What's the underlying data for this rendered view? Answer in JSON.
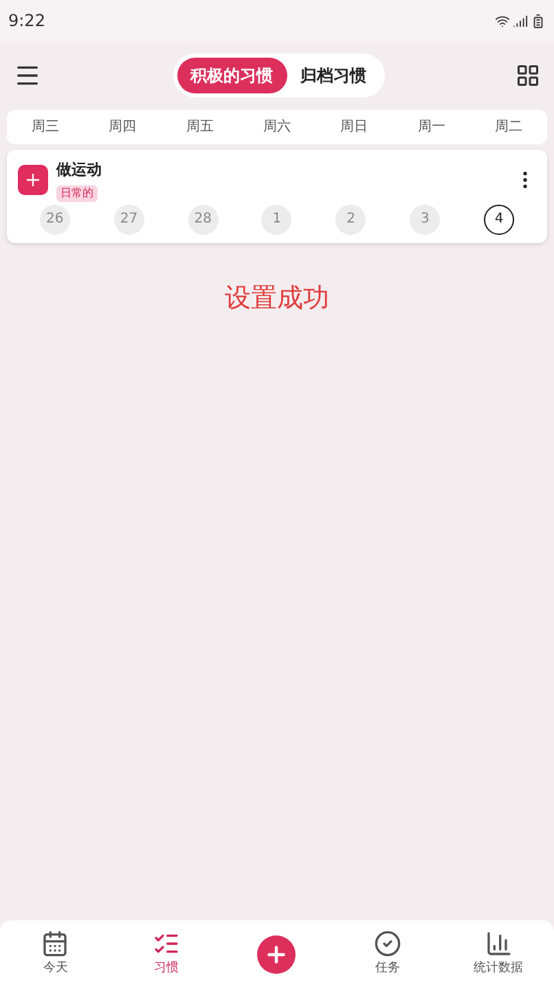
{
  "status_bar": {
    "time": "9:22"
  },
  "segments": [
    {
      "label": "积极的习惯",
      "selected": true
    },
    {
      "label": "归档习惯",
      "selected": false
    }
  ],
  "weekdays": [
    "周三",
    "周四",
    "周五",
    "周六",
    "周日",
    "周一",
    "周二"
  ],
  "habits": [
    {
      "name": "做运动",
      "tag": "日常的",
      "days": [
        {
          "label": "26",
          "selected": false
        },
        {
          "label": "27",
          "selected": false
        },
        {
          "label": "28",
          "selected": false
        },
        {
          "label": "1",
          "selected": false
        },
        {
          "label": "2",
          "selected": false
        },
        {
          "label": "3",
          "selected": false
        },
        {
          "label": "4",
          "selected": true
        }
      ]
    }
  ],
  "toast": "设置成功",
  "nav": [
    {
      "kind": "today",
      "label": "今天",
      "selected": false
    },
    {
      "kind": "habits",
      "label": "习惯",
      "selected": true
    },
    {
      "kind": "add"
    },
    {
      "kind": "tasks",
      "label": "任务",
      "selected": false
    },
    {
      "kind": "stats",
      "label": "统计数据",
      "selected": false
    }
  ]
}
